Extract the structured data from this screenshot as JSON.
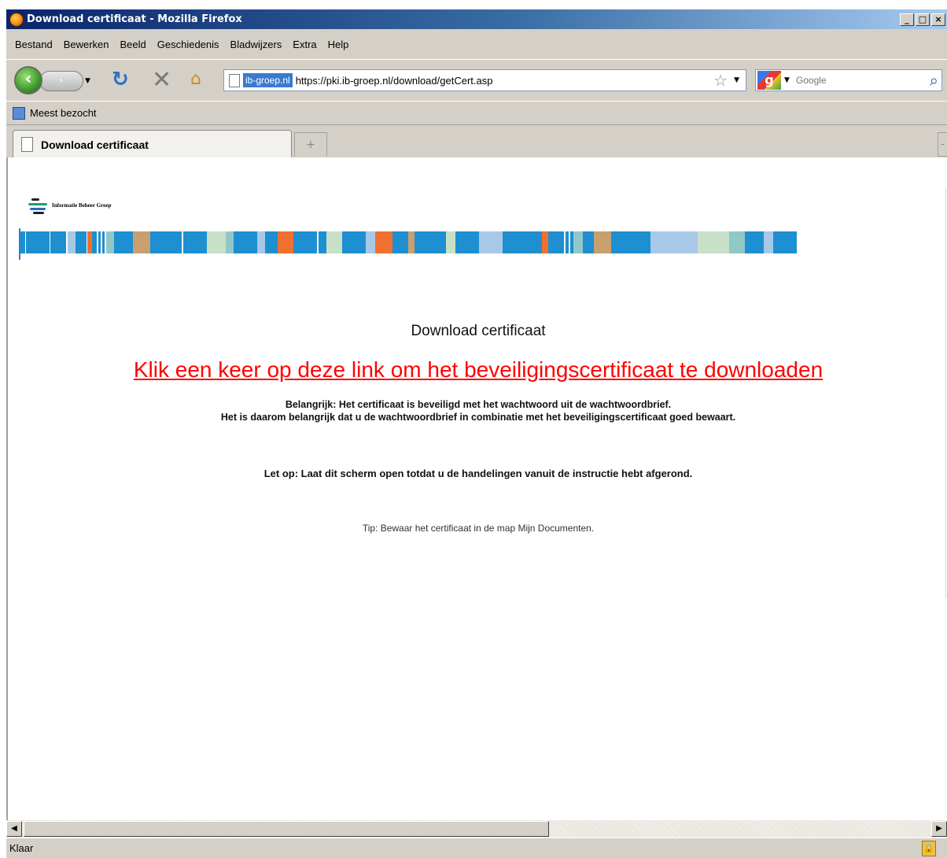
{
  "window": {
    "title": "Download certificaat - Mozilla Firefox",
    "buttons": {
      "minimize": "_",
      "maximize": "□",
      "close": "×"
    }
  },
  "menubar": {
    "items": [
      {
        "label": "Bestand"
      },
      {
        "label": "Bewerken"
      },
      {
        "label": "Beeld"
      },
      {
        "label": "Geschiedenis"
      },
      {
        "label": "Bladwijzers"
      },
      {
        "label": "Extra"
      },
      {
        "label": "Help"
      }
    ]
  },
  "navbar": {
    "back_icon": "back-arrow-icon",
    "forward_icon": "forward-arrow-icon",
    "reload_icon": "reload-icon",
    "stop_icon": "stop-icon",
    "home_icon": "home-icon",
    "site_identity": "ib-groep.nl",
    "url": "https://pki.ib-groep.nl/download/getCert.asp",
    "search": {
      "placeholder": "Google",
      "engine_icon": "google-icon"
    }
  },
  "bookmarks": {
    "items": [
      {
        "label": "Meest bezocht"
      }
    ]
  },
  "tabs": {
    "items": [
      {
        "label": "Download certificaat",
        "active": true
      }
    ],
    "new_tab_label": "+"
  },
  "page": {
    "logo_text": "Informatie Beheer Groep",
    "heading": "Download certificaat",
    "download_link": "Klik een keer op deze link om het beveiligingscertificaat te downloaden",
    "important_line1": "Belangrijk: Het certificaat is beveiligd met het wachtwoord uit de wachtwoordbrief.",
    "important_line2": "Het is daarom belangrijk dat u de wachtwoordbrief in combinatie met het beveiligingscertificaat goed bewaart.",
    "notice": "Let op: Laat dit scherm open totdat u de handelingen vanuit de instructie hebt afgerond.",
    "tip": "Tip: Bewaar het certificaat in de map Mijn Documenten."
  },
  "statusbar": {
    "text": "Klaar",
    "lock_icon": "padlock-icon"
  },
  "colors": {
    "link": "#ff0000",
    "stripe_blue": "#1e8fd0",
    "stripe_light_blue": "#a8c8e8",
    "stripe_orange": "#f07030",
    "stripe_tan": "#c8a070",
    "stripe_pale_green": "#c8e0c8",
    "stripe_teal": "#90c8c8"
  }
}
